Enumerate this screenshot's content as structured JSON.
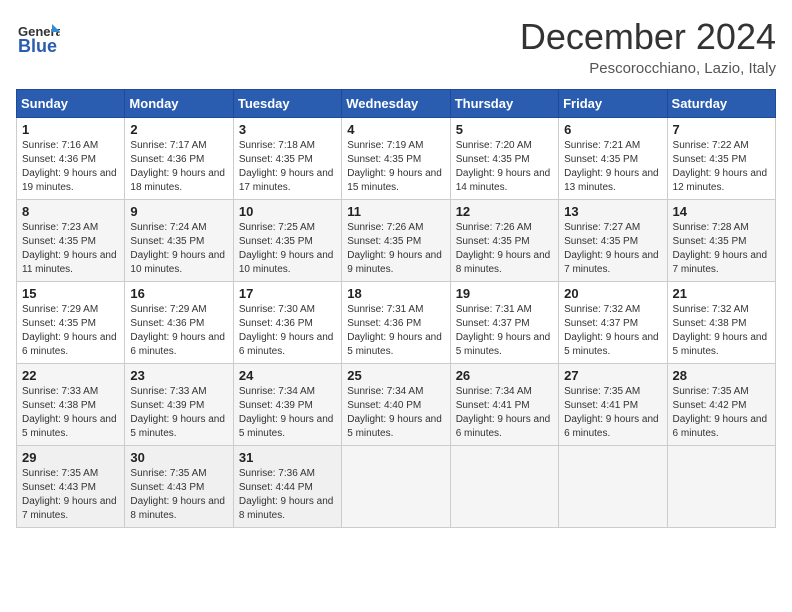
{
  "logo": {
    "general": "General",
    "blue": "Blue"
  },
  "title": "December 2024",
  "location": "Pescorocchiano, Lazio, Italy",
  "days_of_week": [
    "Sunday",
    "Monday",
    "Tuesday",
    "Wednesday",
    "Thursday",
    "Friday",
    "Saturday"
  ],
  "weeks": [
    [
      {
        "day": 1,
        "sunrise": "7:16 AM",
        "sunset": "4:36 PM",
        "daylight": "9 hours and 19 minutes."
      },
      {
        "day": 2,
        "sunrise": "7:17 AM",
        "sunset": "4:36 PM",
        "daylight": "9 hours and 18 minutes."
      },
      {
        "day": 3,
        "sunrise": "7:18 AM",
        "sunset": "4:35 PM",
        "daylight": "9 hours and 17 minutes."
      },
      {
        "day": 4,
        "sunrise": "7:19 AM",
        "sunset": "4:35 PM",
        "daylight": "9 hours and 15 minutes."
      },
      {
        "day": 5,
        "sunrise": "7:20 AM",
        "sunset": "4:35 PM",
        "daylight": "9 hours and 14 minutes."
      },
      {
        "day": 6,
        "sunrise": "7:21 AM",
        "sunset": "4:35 PM",
        "daylight": "9 hours and 13 minutes."
      },
      {
        "day": 7,
        "sunrise": "7:22 AM",
        "sunset": "4:35 PM",
        "daylight": "9 hours and 12 minutes."
      }
    ],
    [
      {
        "day": 8,
        "sunrise": "7:23 AM",
        "sunset": "4:35 PM",
        "daylight": "9 hours and 11 minutes."
      },
      {
        "day": 9,
        "sunrise": "7:24 AM",
        "sunset": "4:35 PM",
        "daylight": "9 hours and 10 minutes."
      },
      {
        "day": 10,
        "sunrise": "7:25 AM",
        "sunset": "4:35 PM",
        "daylight": "9 hours and 10 minutes."
      },
      {
        "day": 11,
        "sunrise": "7:26 AM",
        "sunset": "4:35 PM",
        "daylight": "9 hours and 9 minutes."
      },
      {
        "day": 12,
        "sunrise": "7:26 AM",
        "sunset": "4:35 PM",
        "daylight": "9 hours and 8 minutes."
      },
      {
        "day": 13,
        "sunrise": "7:27 AM",
        "sunset": "4:35 PM",
        "daylight": "9 hours and 7 minutes."
      },
      {
        "day": 14,
        "sunrise": "7:28 AM",
        "sunset": "4:35 PM",
        "daylight": "9 hours and 7 minutes."
      }
    ],
    [
      {
        "day": 15,
        "sunrise": "7:29 AM",
        "sunset": "4:35 PM",
        "daylight": "9 hours and 6 minutes."
      },
      {
        "day": 16,
        "sunrise": "7:29 AM",
        "sunset": "4:36 PM",
        "daylight": "9 hours and 6 minutes."
      },
      {
        "day": 17,
        "sunrise": "7:30 AM",
        "sunset": "4:36 PM",
        "daylight": "9 hours and 6 minutes."
      },
      {
        "day": 18,
        "sunrise": "7:31 AM",
        "sunset": "4:36 PM",
        "daylight": "9 hours and 5 minutes."
      },
      {
        "day": 19,
        "sunrise": "7:31 AM",
        "sunset": "4:37 PM",
        "daylight": "9 hours and 5 minutes."
      },
      {
        "day": 20,
        "sunrise": "7:32 AM",
        "sunset": "4:37 PM",
        "daylight": "9 hours and 5 minutes."
      },
      {
        "day": 21,
        "sunrise": "7:32 AM",
        "sunset": "4:38 PM",
        "daylight": "9 hours and 5 minutes."
      }
    ],
    [
      {
        "day": 22,
        "sunrise": "7:33 AM",
        "sunset": "4:38 PM",
        "daylight": "9 hours and 5 minutes."
      },
      {
        "day": 23,
        "sunrise": "7:33 AM",
        "sunset": "4:39 PM",
        "daylight": "9 hours and 5 minutes."
      },
      {
        "day": 24,
        "sunrise": "7:34 AM",
        "sunset": "4:39 PM",
        "daylight": "9 hours and 5 minutes."
      },
      {
        "day": 25,
        "sunrise": "7:34 AM",
        "sunset": "4:40 PM",
        "daylight": "9 hours and 5 minutes."
      },
      {
        "day": 26,
        "sunrise": "7:34 AM",
        "sunset": "4:41 PM",
        "daylight": "9 hours and 6 minutes."
      },
      {
        "day": 27,
        "sunrise": "7:35 AM",
        "sunset": "4:41 PM",
        "daylight": "9 hours and 6 minutes."
      },
      {
        "day": 28,
        "sunrise": "7:35 AM",
        "sunset": "4:42 PM",
        "daylight": "9 hours and 6 minutes."
      }
    ],
    [
      {
        "day": 29,
        "sunrise": "7:35 AM",
        "sunset": "4:43 PM",
        "daylight": "9 hours and 7 minutes."
      },
      {
        "day": 30,
        "sunrise": "7:35 AM",
        "sunset": "4:43 PM",
        "daylight": "9 hours and 8 minutes."
      },
      {
        "day": 31,
        "sunrise": "7:36 AM",
        "sunset": "4:44 PM",
        "daylight": "9 hours and 8 minutes."
      },
      null,
      null,
      null,
      null
    ]
  ]
}
